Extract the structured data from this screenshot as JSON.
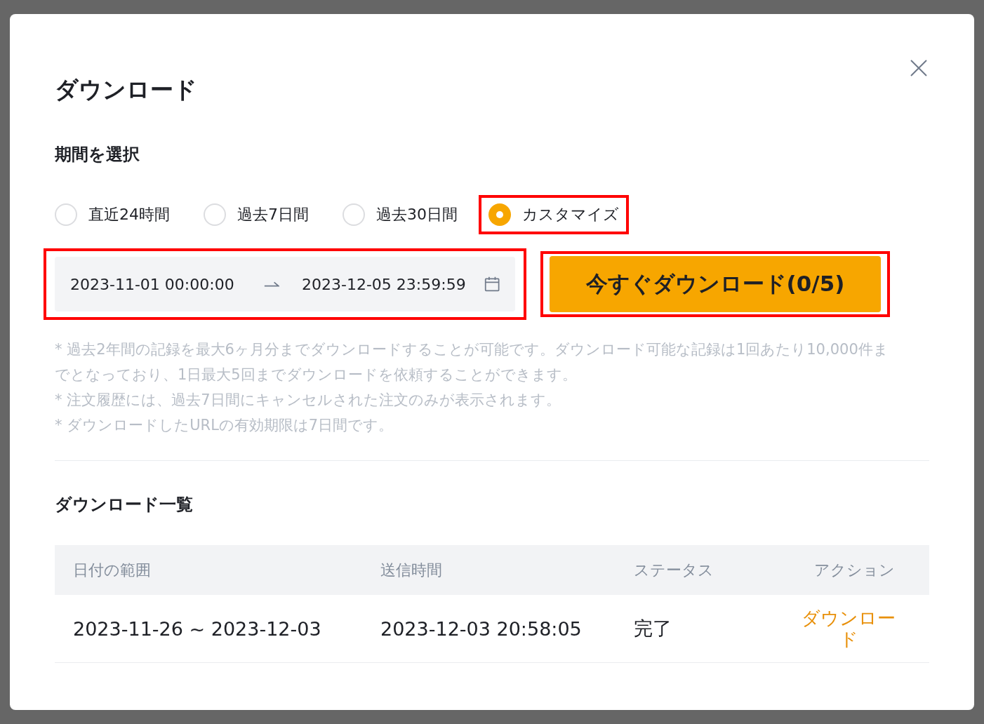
{
  "dialog": {
    "title": "ダウンロード"
  },
  "period": {
    "heading": "期間を選択",
    "options": [
      {
        "label": "直近24時間",
        "selected": false,
        "highlighted": false
      },
      {
        "label": "過去7日間",
        "selected": false,
        "highlighted": false
      },
      {
        "label": "過去30日間",
        "selected": false,
        "highlighted": false
      },
      {
        "label": "カスタマイズ",
        "selected": true,
        "highlighted": true
      }
    ],
    "range": {
      "start": "2023-11-01 00:00:00",
      "end": "2023-12-05 23:59:59",
      "highlighted": true
    },
    "download_button": {
      "label": "今すぐダウンロード(0/5)",
      "highlighted": true
    }
  },
  "notes": [
    "* 過去2年間の記録を最大6ヶ月分までダウンロードすることが可能です。ダウンロード可能な記録は1回あたり10,000件までとなっており、1日最大5回までダウンロードを依頼することができます。",
    "* 注文履歴には、過去7日間にキャンセルされた注文のみが表示されます。",
    "* ダウンロードしたURLの有効期限は7日間です。"
  ],
  "list": {
    "heading": "ダウンロード一覧",
    "columns": [
      "日付の範囲",
      "送信時間",
      "ステータス",
      "アクション"
    ],
    "rows": [
      {
        "range": "2023-11-26 ~ 2023-12-03",
        "sent": "2023-12-03 20:58:05",
        "status": "完了",
        "action": "ダウンロード"
      }
    ]
  }
}
